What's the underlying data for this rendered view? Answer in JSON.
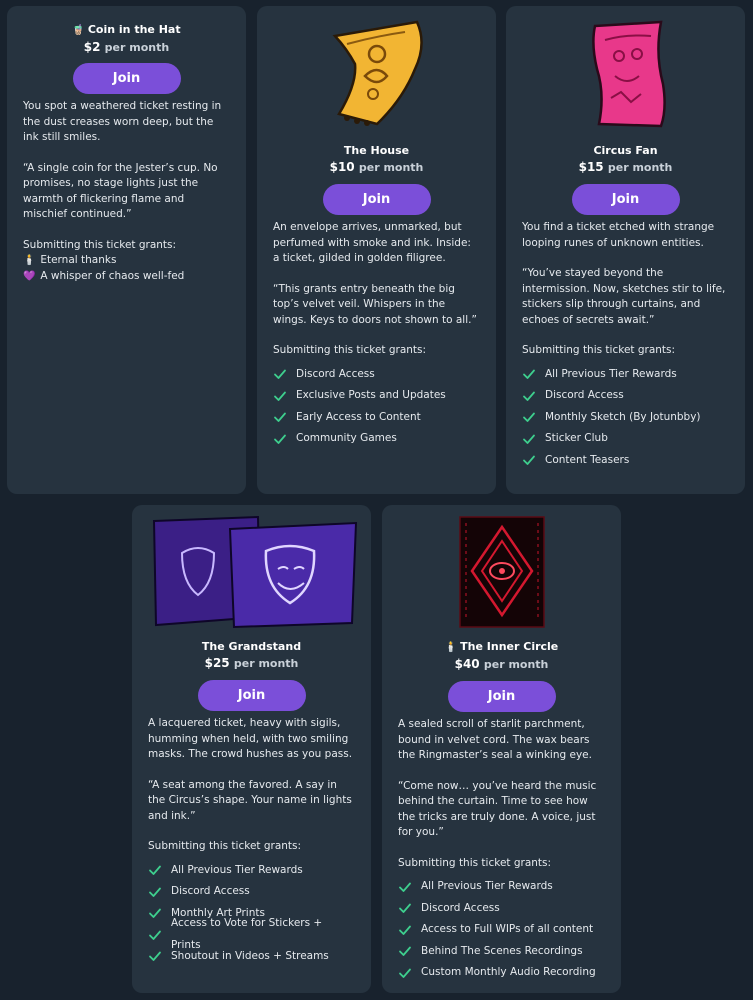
{
  "tiers": [
    {
      "title": "Coin in the Hat",
      "title_icon": "🧋",
      "price": "$2",
      "per": "per month",
      "join_label": "Join",
      "description": "You spot a weathered ticket resting in the dust creases worn deep, but the ink still smiles.",
      "quote": "“A single coin for the Jester’s cup. No promises, no stage lights just the warmth of flickering flame and mischief continued.”",
      "grants_label": "Submitting this ticket grants:",
      "emoji_benefits": [
        {
          "icon": "🕯️",
          "text": "Eternal thanks"
        },
        {
          "icon": "💜",
          "text": "A whisper of chaos well-fed"
        }
      ]
    },
    {
      "title": "The House",
      "price": "$10",
      "per": "per month",
      "join_label": "Join",
      "description": "An envelope arrives, unmarked, but perfumed with smoke and ink. Inside: a ticket, gilded in golden filigree.",
      "quote": "“This grants entry beneath the big top’s velvet veil. Whispers in the wings. Keys to doors not shown to all.”",
      "grants_label": "Submitting this ticket grants:",
      "benefits": [
        "Discord Access",
        "Exclusive Posts and Updates",
        "Early Access to Content",
        "Community Games"
      ],
      "art_color": "#f2b533"
    },
    {
      "title": "Circus Fan",
      "price": "$15",
      "per": "per month",
      "join_label": "Join",
      "description": "You find a ticket etched with strange looping runes of unknown entities.",
      "quote": "“You’ve stayed beyond the intermission. Now, sketches stir to life, stickers slip through curtains, and echoes of secrets await.”",
      "grants_label": "Submitting this ticket grants:",
      "benefits": [
        "All Previous Tier Rewards",
        "Discord Access",
        "Monthly Sketch (By Jotunbby)",
        "Sticker Club",
        "Content Teasers"
      ],
      "art_color": "#e8388a"
    },
    {
      "title": "The Grandstand",
      "price": "$25",
      "per": "per month",
      "join_label": "Join",
      "description": "A lacquered ticket, heavy with sigils, humming when held, with two smiling masks. The crowd hushes as you pass.",
      "quote": "“A seat among the favored. A say in the Circus’s shape. Your name in lights and ink.”",
      "grants_label": "Submitting this ticket grants:",
      "benefits": [
        "All Previous Tier Rewards",
        "Discord Access",
        "Monthly Art Prints",
        "Access to Vote for Stickers + Prints",
        "Shoutout in Videos + Streams"
      ],
      "art_color": "#5a2fb5"
    },
    {
      "title": "The Inner Circle",
      "title_icon": "🕯️",
      "price": "$40",
      "per": "per month",
      "join_label": "Join",
      "description": "A sealed scroll of starlit parchment, bound in velvet cord. The wax bears the Ringmaster’s seal a winking eye.",
      "quote": "“Come now… you’ve heard the music behind the curtain. Time to see how the tricks are truly done. A voice, just for you.”",
      "grants_label": "Submitting this ticket grants:",
      "benefits": [
        "All Previous Tier Rewards",
        "Discord Access",
        "Access to Full WIPs of all content",
        "Behind The Scenes Recordings",
        "Custom Monthly Audio Recording"
      ],
      "art_color": "#d4182f"
    }
  ],
  "colors": {
    "page_bg": "#18222d",
    "card_bg": "#26333f",
    "accent": "#7b4fd9",
    "check": "#3ecf8e"
  }
}
